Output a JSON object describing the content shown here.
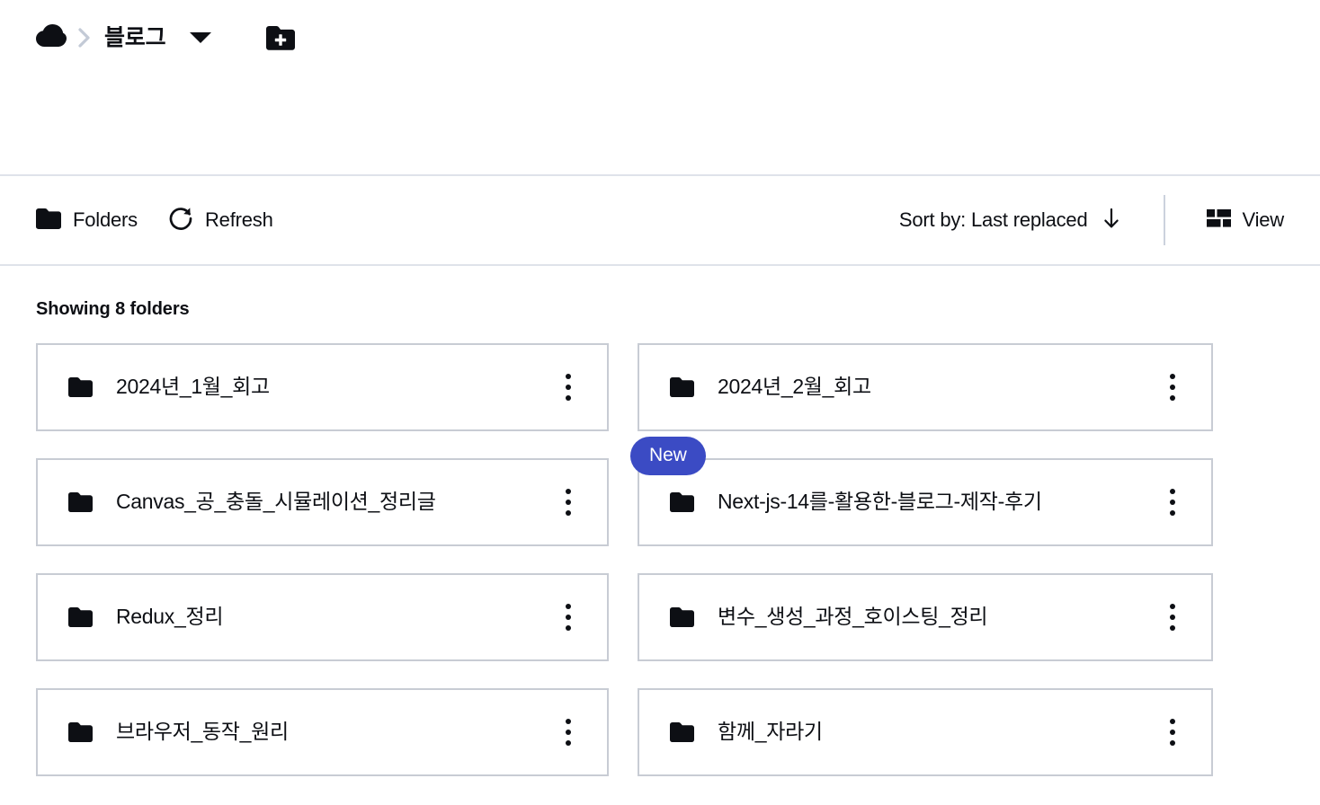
{
  "header": {
    "cloud_icon": "cloud-icon",
    "separator_icon": "chevron-right-icon",
    "breadcrumb_label": "블로그",
    "caret_icon": "caret-down-icon",
    "new_folder_icon": "new-folder-icon"
  },
  "toolbar": {
    "folders_label": "Folders",
    "folders_icon": "folder-icon",
    "refresh_label": "Refresh",
    "refresh_icon": "refresh-icon",
    "sort_label": "Sort by: Last replaced",
    "sort_direction_icon": "arrow-down-icon",
    "view_label": "View",
    "view_icon": "layout-grid-icon"
  },
  "content": {
    "showing_text": "Showing 8 folders",
    "kebab_icon": "more-vertical-icon",
    "folder_icon": "folder-icon",
    "new_badge_label": "New"
  },
  "colors": {
    "badge_blue": "#3b4bc4",
    "card_border": "#c8ccd4",
    "toolbar_border": "#dfe3ea",
    "divider": "#ccd2dd",
    "text": "#0d0f14",
    "chevron_muted": "#c3cad6"
  },
  "folders": [
    {
      "name": "2024년_1월_회고",
      "badge": null
    },
    {
      "name": "2024년_2월_회고",
      "badge": null
    },
    {
      "name": "Canvas_공_충돌_시뮬레이션_정리글",
      "badge": null
    },
    {
      "name": "Next-js-14를-활용한-블로그-제작-후기",
      "badge": "New"
    },
    {
      "name": "Redux_정리",
      "badge": null
    },
    {
      "name": "변수_생성_과정_호이스팅_정리",
      "badge": null
    },
    {
      "name": "브라우저_동작_원리",
      "badge": null
    },
    {
      "name": "함께_자라기",
      "badge": null
    }
  ]
}
